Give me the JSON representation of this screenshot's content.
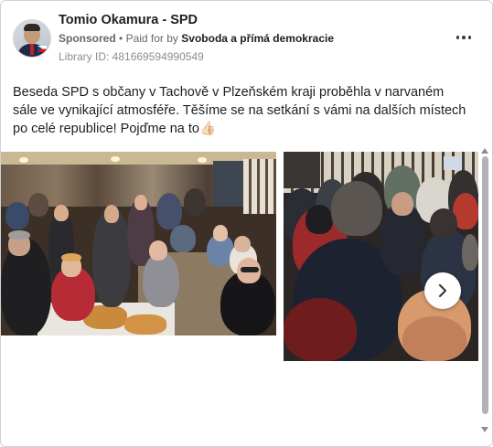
{
  "ad": {
    "page_name": "Tomio Okamura - SPD",
    "sponsored_label": "Sponsored",
    "separator": "•",
    "paid_for_prefix": "Paid for by",
    "payer": "Svoboda a přímá demokracie",
    "library_id": "Library ID: 481669594990549",
    "body": "Beseda SPD s občany v Tachově v Plzeňském kraji proběhla v narvaném sále ve vynikající atmosféře. Těšíme se na setkání s vámi na dalších místech po celé republice! Pojďme na to",
    "body_emoji": "👍🏻"
  },
  "icons": {
    "more": "more-options-icon",
    "next": "chevron-right-icon",
    "scroll_up": "scroll-up-arrow-icon",
    "scroll_down": "scroll-down-arrow-icon"
  },
  "colors": {
    "text": "#1c1e21",
    "secondary_text": "#65676b",
    "muted_text": "#8a8d91",
    "scrollbar": "#b0b3b8"
  }
}
